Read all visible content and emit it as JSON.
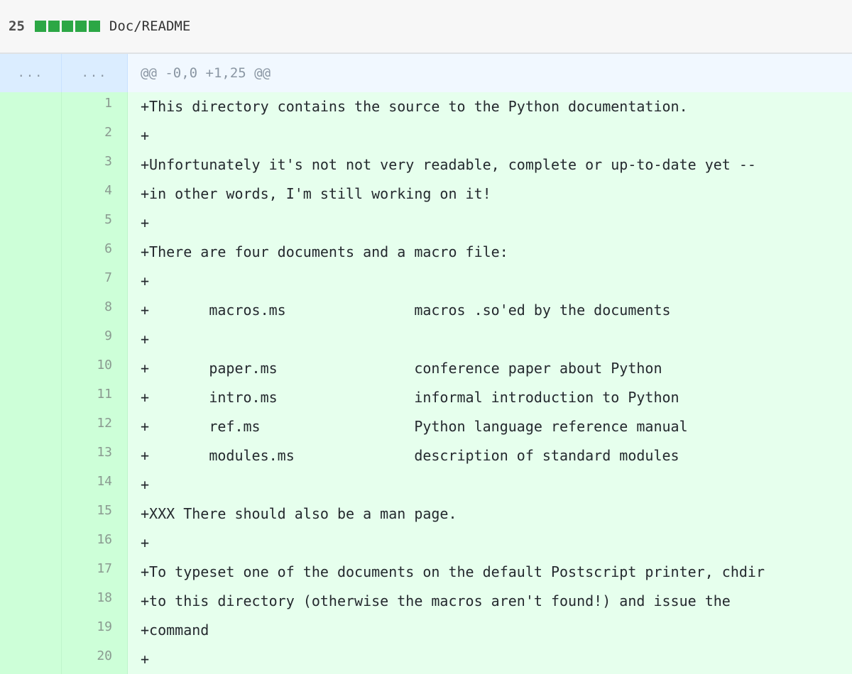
{
  "file_header": {
    "change_count": "25",
    "diffstat_colors": [
      "#2ca745",
      "#2ca745",
      "#2ca745",
      "#2ca745",
      "#2ca745"
    ],
    "file_path": "Doc/README"
  },
  "hunk": {
    "old_expander": "...",
    "new_expander": "...",
    "header": "@@ -0,0 +1,25 @@"
  },
  "lines": [
    {
      "num": "1",
      "text": "+This directory contains the source to the Python documentation."
    },
    {
      "num": "2",
      "text": "+"
    },
    {
      "num": "3",
      "text": "+Unfortunately it's not not very readable, complete or up-to-date yet --"
    },
    {
      "num": "4",
      "text": "+in other words, I'm still working on it!"
    },
    {
      "num": "5",
      "text": "+"
    },
    {
      "num": "6",
      "text": "+There are four documents and a macro file:"
    },
    {
      "num": "7",
      "text": "+"
    },
    {
      "num": "8",
      "text": "+       macros.ms               macros .so'ed by the documents"
    },
    {
      "num": "9",
      "text": "+"
    },
    {
      "num": "10",
      "text": "+       paper.ms                conference paper about Python"
    },
    {
      "num": "11",
      "text": "+       intro.ms                informal introduction to Python"
    },
    {
      "num": "12",
      "text": "+       ref.ms                  Python language reference manual"
    },
    {
      "num": "13",
      "text": "+       modules.ms              description of standard modules"
    },
    {
      "num": "14",
      "text": "+"
    },
    {
      "num": "15",
      "text": "+XXX There should also be a man page."
    },
    {
      "num": "16",
      "text": "+"
    },
    {
      "num": "17",
      "text": "+To typeset one of the documents on the default Postscript printer, chdir"
    },
    {
      "num": "18",
      "text": "+to this directory (otherwise the macros aren't found!) and issue the"
    },
    {
      "num": "19",
      "text": "+command"
    },
    {
      "num": "20",
      "text": "+"
    }
  ]
}
